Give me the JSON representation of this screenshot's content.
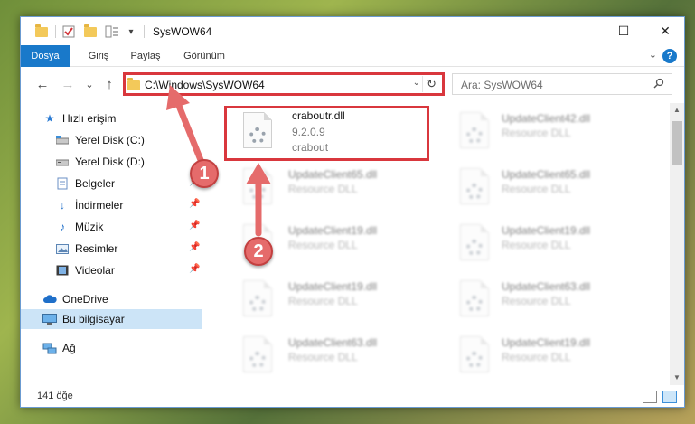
{
  "window": {
    "title": "SysWOW64",
    "controls": {
      "minimize": "—",
      "maximize": "☐",
      "close": "✕"
    }
  },
  "quick_access_toolbar": {
    "icons": [
      "folder-icon",
      "properties-icon",
      "new-folder-icon",
      "customize-icon"
    ],
    "dropdown": "▾"
  },
  "ribbon": {
    "tabs": [
      "Dosya",
      "Giriş",
      "Paylaş",
      "Görünüm"
    ],
    "help": "?"
  },
  "navigation": {
    "back": "←",
    "forward": "→",
    "recent": "⌄",
    "up": "↑"
  },
  "address_bar": {
    "path": "C:\\Windows\\SysWOW64",
    "dropdown": "⌄",
    "refresh": "↻"
  },
  "search": {
    "placeholder": "Ara: SysWOW64"
  },
  "sidebar": {
    "quick_access": "Hızlı erişim",
    "items": [
      {
        "label": "Yerel Disk (C:)",
        "icon": "drive-icon",
        "pinned": false
      },
      {
        "label": "Yerel Disk (D:)",
        "icon": "drive-icon",
        "pinned": false
      },
      {
        "label": "Belgeler",
        "icon": "documents-icon",
        "pinned": true
      },
      {
        "label": "İndirmeler",
        "icon": "downloads-icon",
        "pinned": true
      },
      {
        "label": "Müzik",
        "icon": "music-icon",
        "pinned": true
      },
      {
        "label": "Resimler",
        "icon": "pictures-icon",
        "pinned": true
      },
      {
        "label": "Videolar",
        "icon": "videos-icon",
        "pinned": true
      }
    ],
    "onedrive": "OneDrive",
    "this_pc": "Bu bilgisayar",
    "network": "Ağ",
    "pin_glyph": "📌"
  },
  "files": [
    {
      "name": "craboutr.dll",
      "version": "9.2.0.9",
      "desc": "crabout",
      "highlighted": true
    },
    {
      "name": "UpdateClient42.dll",
      "desc": "Resource DLL"
    },
    {
      "name": "UpdateClient65.dll",
      "desc": "Resource DLL"
    },
    {
      "name": "UpdateClient65.dll",
      "desc": "Resource DLL"
    },
    {
      "name": "UpdateClient19.dll",
      "desc": "Resource DLL"
    },
    {
      "name": "UpdateClient19.dll",
      "desc": "Resource DLL"
    },
    {
      "name": "UpdateClient19.dll",
      "desc": "Resource DLL"
    },
    {
      "name": "UpdateClient63.dll",
      "desc": "Resource DLL"
    },
    {
      "name": "UpdateClient63.dll",
      "desc": "Resource DLL"
    },
    {
      "name": "UpdateClient19.dll",
      "desc": "Resource DLL"
    }
  ],
  "status": {
    "count": "141 öğe"
  },
  "annotations": {
    "step1": "1",
    "step2": "2"
  },
  "colors": {
    "accent": "#1979ca",
    "highlight": "#d9373d",
    "arrow": "#e56b6b",
    "selected": "#cce4f7"
  }
}
